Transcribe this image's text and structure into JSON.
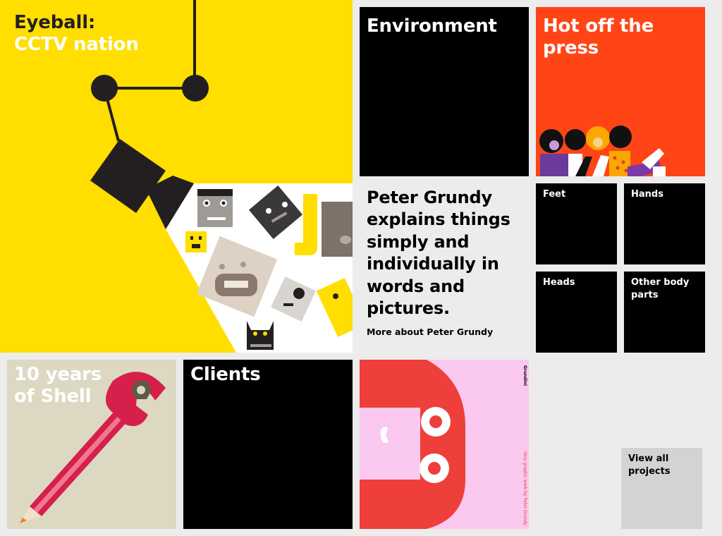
{
  "tiles": {
    "eyeball": {
      "title_line1": "Eyeball:",
      "title_line2": "CCTV nation"
    },
    "environment": {
      "title": "Environment"
    },
    "hot_off_press": {
      "title_line1": "Hot off the",
      "title_line2": "press"
    },
    "intro": {
      "headline": "Peter Grundy explains things simply and individually in words and pictures.",
      "link": "More about Peter Grundy"
    },
    "feet": {
      "title": "Feet"
    },
    "hands": {
      "title": "Hands"
    },
    "heads": {
      "title": "Heads"
    },
    "other_body_parts": {
      "title": "Other body parts"
    },
    "shell": {
      "title_line1": "10 years",
      "title_line2": "of Shell"
    },
    "clients": {
      "title": "Clients"
    },
    "grundini": {
      "brand": "Grundini",
      "tagline": "Very graphic work by Peter Grundy"
    },
    "view_all": {
      "label": "View all projects"
    }
  },
  "colors": {
    "yellow": "#ffde00",
    "black": "#000000",
    "orange_red": "#ff4516",
    "beige": "#ddd8c2",
    "pink": "#fbc8f0",
    "red": "#ee3f3a",
    "grey_button": "#d3d3d3",
    "background": "#ececec"
  }
}
